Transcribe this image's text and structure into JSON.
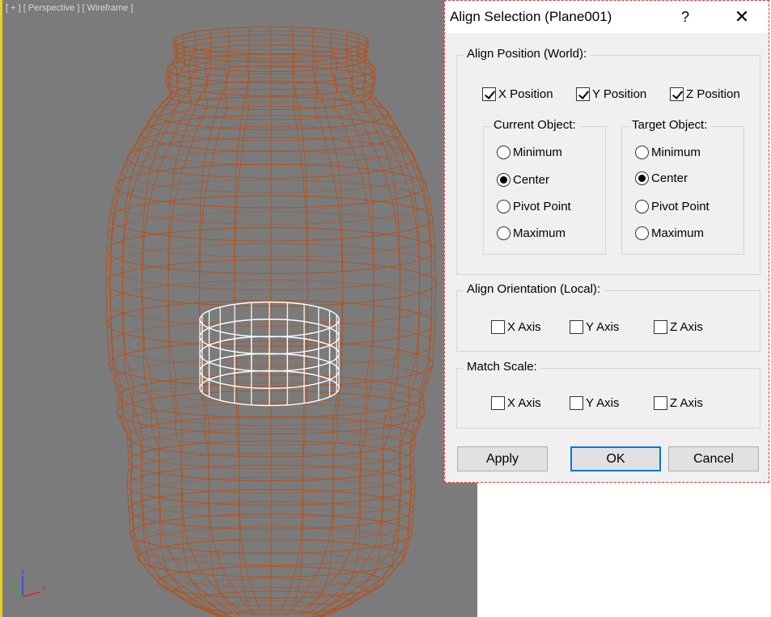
{
  "viewport": {
    "label": "[ + ] [ Perspective ] [ Wireframe ]",
    "axis": {
      "z": "z",
      "y": "y",
      "x": "x"
    },
    "colors": {
      "bg": "#7b7b7b",
      "mesh": "#b5501a",
      "selected": "#ffffff",
      "border": "#e8d21a"
    }
  },
  "dialog": {
    "title": "Align Selection (Plane001)",
    "help": "?",
    "close": "✕",
    "align_position": {
      "label": "Align Position (World):",
      "x": {
        "label": "X Position",
        "checked": true
      },
      "y": {
        "label": "Y Position",
        "checked": true
      },
      "z": {
        "label": "Z Position",
        "checked": true
      },
      "current": {
        "label": "Current Object:",
        "options": [
          "Minimum",
          "Center",
          "Pivot Point",
          "Maximum"
        ],
        "selected": "Center"
      },
      "target": {
        "label": "Target Object:",
        "options": [
          "Minimum",
          "Center",
          "Pivot Point",
          "Maximum"
        ],
        "selected": "Center"
      }
    },
    "align_orientation": {
      "label": "Align Orientation (Local):",
      "x": {
        "label": "X Axis",
        "checked": false
      },
      "y": {
        "label": "Y Axis",
        "checked": false
      },
      "z": {
        "label": "Z Axis",
        "checked": false
      }
    },
    "match_scale": {
      "label": "Match Scale:",
      "x": {
        "label": "X Axis",
        "checked": false
      },
      "y": {
        "label": "Y Axis",
        "checked": false
      },
      "z": {
        "label": "Z Axis",
        "checked": false
      }
    },
    "buttons": {
      "apply": "Apply",
      "ok": "OK",
      "cancel": "Cancel"
    }
  }
}
